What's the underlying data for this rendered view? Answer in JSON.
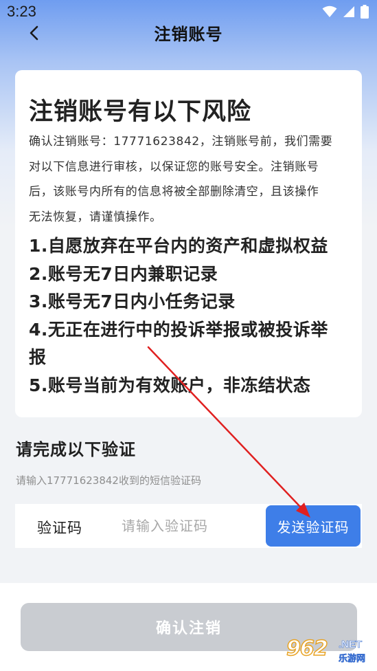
{
  "status_bar": {
    "time": "3:23",
    "icons": [
      "wifi-icon",
      "signal-icon",
      "battery-icon"
    ]
  },
  "nav": {
    "back_icon": "chevron-left-icon",
    "title": "注销账号"
  },
  "risk_card": {
    "title": "注销账号有以下风险",
    "description_lines": [
      "确认注销账号：17771623842，注销账号前，我们需要",
      "对以下信息进行审核，以保证您的账号安全。注销账号",
      "后，该账号内所有的信息将被全部删除清空，且该操作",
      "无法恢复，请谨慎操作。"
    ],
    "items": [
      "1.自愿放弃在平台内的资产和虚拟权益",
      "2.账号无7日内兼职记录",
      "3.账号无7日内小任务记录",
      "4.无正在进行中的投诉举报或被投诉举",
      "报",
      "5.账号当前为有效账户，非冻结状态"
    ]
  },
  "verify": {
    "heading": "请完成以下验证",
    "hint": "请输入17771623842收到的短信验证码",
    "code_label": "验证码",
    "code_placeholder": "请输入验证码",
    "code_value": "",
    "send_button": "发送验证码"
  },
  "confirm_button": "确认注销",
  "watermark": {
    "digits": "962",
    "suffix": ".NET",
    "cn": "乐游网"
  },
  "colors": {
    "accent": "#3e7ee8",
    "disabled_button": "#c9ccd1",
    "annotation_arrow": "#e02020"
  }
}
